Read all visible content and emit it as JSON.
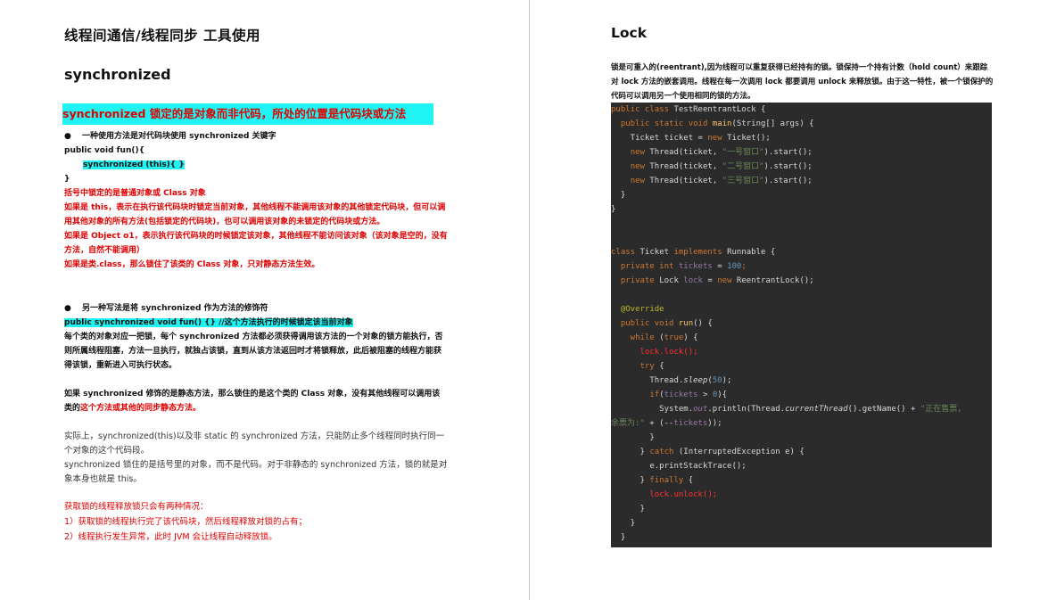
{
  "left": {
    "title": "线程间通信/线程同步  工具使用",
    "subtitle": "synchronized",
    "highlight": "synchronized 锁定的是对象而非代码，所处的位置是代码块或方法",
    "bullet1": "一种使用方法是对代码块使用 synchronized 关键字",
    "bullet_symbol": "●",
    "code1": "public void fun(){",
    "code2": "synchronized (this){ }",
    "code3": "}",
    "red1": "括号中锁定的是普通对象或 Class 对象",
    "red2": "如果是 this，表示在执行该代码块时锁定当前对象，其他线程不能调用该对象的其他锁定代码块，但可以调用其他对象的所有方法(包括锁定的代码块)，也可以调用该对象的未锁定的代码块或方法。",
    "red3": "如果是 Object o1，表示执行该代码块的时候锁定该对象，其他线程不能访问该对象（该对象是空的，没有方法，自然不能调用）",
    "red4": "如果是类.class，那么锁住了该类的 Class 对象，只对静态方法生效。",
    "bullet2": "另一种写法是将 synchronized 作为方法的修饰符",
    "code4": "public synchronized void fun() {} //这个方法执行的时候锁定该当前对象",
    "para1": "每个类的对象对应一把锁，每个 synchronized 方法都必须获得调用该方法的一个对象的锁方能执行，否则所属线程阻塞，方法一旦执行，就独占该锁，直到从该方法返回时才将锁释放，此后被阻塞的线程方能获得该锁，重新进入可执行状态。",
    "para2a": "如果 synchronized 修饰的是静态方法，那么锁住的是这个类的 Class 对象，没有其他线程可以调用该类的",
    "para2b": "这个方法或其他的同步静态方法。",
    "para3": "实际上，synchronized(this)以及非 static 的 synchronized 方法，只能防止多个线程同时执行同一个对象的这个代码段。",
    "para4": "synchronized 锁住的是括号里的对象，而不是代码。对于非静态的 synchronized 方法，锁的就是对象本身也就是 this。",
    "red5": "获取锁的线程释放锁只会有两种情况：",
    "red6": "1）获取锁的线程执行完了该代码块，然后线程释放对锁的占有；",
    "red7": "2）线程执行发生异常，此时 JVM 会让线程自动释放锁。"
  },
  "right": {
    "title": "Lock",
    "para": "锁是可重入的(reentrant),因为线程可以重复获得已经持有的锁。锁保持一个持有计数（hold count）来跟踪对 lock 方法的嵌套调用。线程在每一次调用 lock 都要调用 unlock 来释放锁。由于这一特性，被一个锁保护的代码可以调用另一个使用相同的锁的方法。",
    "code": {
      "l1a": "public class ",
      "l1b": "TestReentrantLock {",
      "l2a": "  public static void ",
      "l2b": "main",
      "l2c": "(String[] args) {",
      "l3a": "    Ticket ticket = ",
      "l3b": "new ",
      "l3c": "Ticket();",
      "l4a": "    ",
      "l4b": "new ",
      "l4c": "Thread(ticket, ",
      "l4d": "\"一号窗口\"",
      "l4e": ").start();",
      "l5d": "\"二号窗口\"",
      "l6d": "\"三号窗口\"",
      "close1": "  }",
      "close0": "}",
      "l7a": "class ",
      "l7b": "Ticket ",
      "l7c": "implements ",
      "l7d": "Runnable {",
      "l8a": "  private int ",
      "l8b": "tickets",
      "l8c": " = ",
      "l8d": "100",
      "l8e": ";",
      "l9a": "  private ",
      "l9b": "Lock ",
      "l9c": "lock",
      "l9d": " = ",
      "l9e": "new ",
      "l9f": "ReentrantLock();",
      "l10": "  @Override",
      "l11a": "  public void ",
      "l11b": "run",
      "l11c": "() {",
      "l12a": "    while ",
      "l12b": "(",
      "l12c": "true",
      "l12d": ") {",
      "l13": "      lock.lock();",
      "l14a": "      try ",
      "l14b": "{",
      "l15a": "        Thread.",
      "l15b": "sleep",
      "l15c": "(",
      "l15d": "50",
      "l15e": ");",
      "l16a": "        if",
      "l16b": "(",
      "l16c": "tickets",
      "l16d": " > ",
      "l16e": "0",
      "l16f": "){",
      "l17a": "          System.",
      "l17b": "out",
      "l17c": ".println(Thread.",
      "l17d": "currentThread",
      "l17e": "().getName() + ",
      "l17f": "\"正在售票,",
      "l18a": "余票为:\"",
      "l18b": " + (--",
      "l18c": "tickets",
      "l18d": "));",
      "l19": "        }",
      "l20a": "      } ",
      "l20b": "catch ",
      "l20c": "(InterruptedException e) {",
      "l21": "        e.printStackTrace();",
      "l22a": "      } ",
      "l22b": "finally ",
      "l22c": "{",
      "l23": "        lock.unlock();",
      "l24": "      }",
      "l25": "    }"
    }
  }
}
